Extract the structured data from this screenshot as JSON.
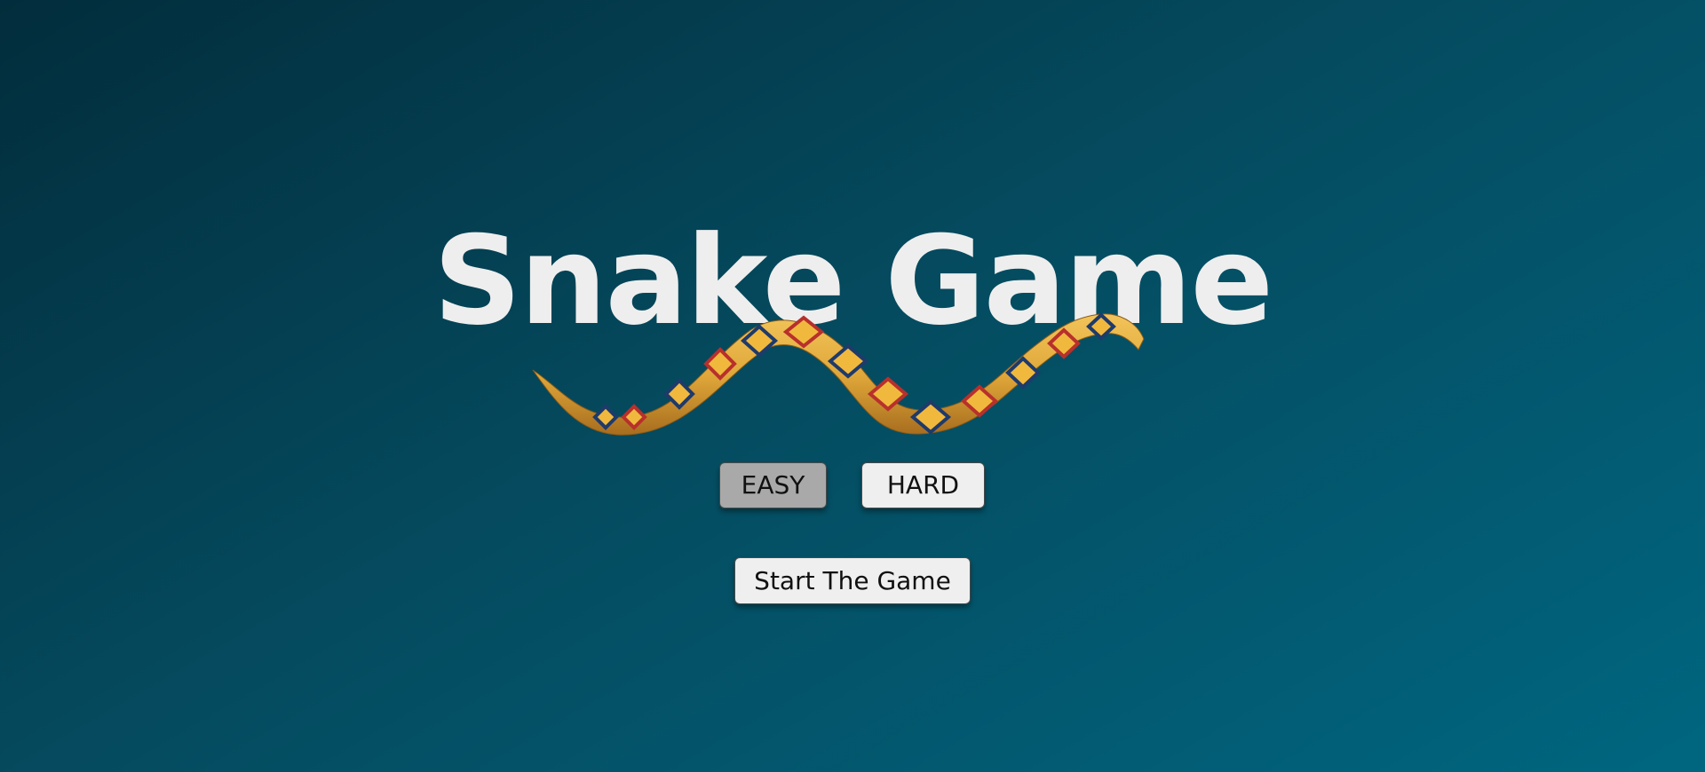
{
  "title": "Snake Game",
  "difficulty": {
    "easy_label": "EASY",
    "hard_label": "HARD",
    "selected": "easy"
  },
  "start_label": "Start The Game",
  "colors": {
    "background_start": "#022d3c",
    "background_end": "#006680",
    "title": "#eeeeee",
    "button": "#efefef",
    "button_selected": "#a9a9a9",
    "snake_body": "#e0a83a",
    "snake_pattern_outer": "#c0392b",
    "snake_pattern_inner": "#2c3e6b"
  }
}
